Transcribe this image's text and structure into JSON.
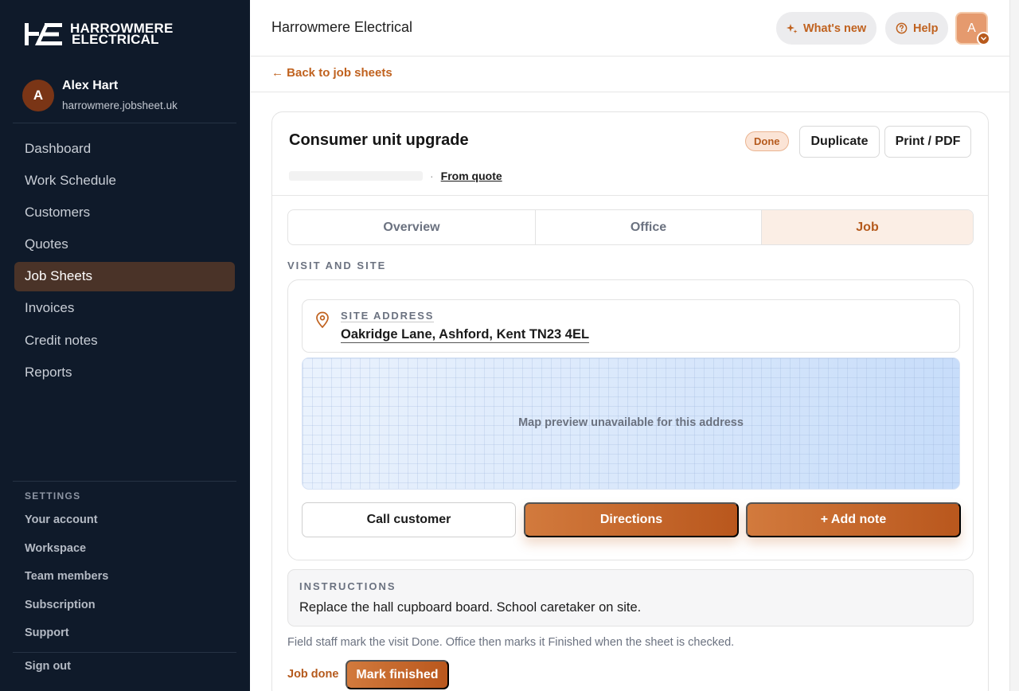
{
  "brand": {
    "line1": "HARROWMERE",
    "line2": "ELECTRICAL",
    "mark": "HE"
  },
  "profile": {
    "initial": "A",
    "name": "Alex Hart",
    "domain": "harrowmere.jobsheet.uk"
  },
  "nav": [
    {
      "label": "Dashboard",
      "active": false
    },
    {
      "label": "Work Schedule",
      "active": false
    },
    {
      "label": "Customers",
      "active": false
    },
    {
      "label": "Quotes",
      "active": false
    },
    {
      "label": "Job Sheets",
      "active": true
    },
    {
      "label": "Invoices",
      "active": false
    },
    {
      "label": "Credit notes",
      "active": false
    },
    {
      "label": "Reports",
      "active": false
    }
  ],
  "settings": {
    "heading": "SETTINGS",
    "items": [
      "Your account",
      "Workspace",
      "Team members",
      "Subscription",
      "Support"
    ],
    "sign_out": "Sign out"
  },
  "topbar": {
    "title": "Harrowmere Electrical",
    "whats_new": "What's new",
    "help": "Help",
    "user_initial": "A"
  },
  "back_link": "← Back to job sheets",
  "job": {
    "title": "Consumer unit upgrade",
    "status": "Done",
    "duplicate_label": "Duplicate",
    "print_label": "Print / PDF",
    "from_quote": "From quote"
  },
  "tabs": [
    {
      "label": "Overview",
      "active": false
    },
    {
      "label": "Office",
      "active": false
    },
    {
      "label": "Job",
      "active": true
    }
  ],
  "visit": {
    "heading": "VISIT AND SITE",
    "address_label": "SITE ADDRESS",
    "address": "Oakridge Lane, Ashford, Kent TN23 4EL",
    "map_text": "Map preview unavailable for this address",
    "call_label": "Call customer",
    "directions_label": "Directions",
    "add_note_label": "+ Add note"
  },
  "instructions": {
    "heading": "INSTRUCTIONS",
    "text": "Replace the hall cupboard board. School caretaker on site."
  },
  "field_note": "Field staff mark the visit Done. Office then marks it Finished when the sheet is checked.",
  "job_done_label": "Job done",
  "mark_finished_label": "Mark finished",
  "colors": {
    "accent": "#c0621f",
    "sidebar": "#0f1a2a",
    "active_nav": "#4a3328"
  }
}
